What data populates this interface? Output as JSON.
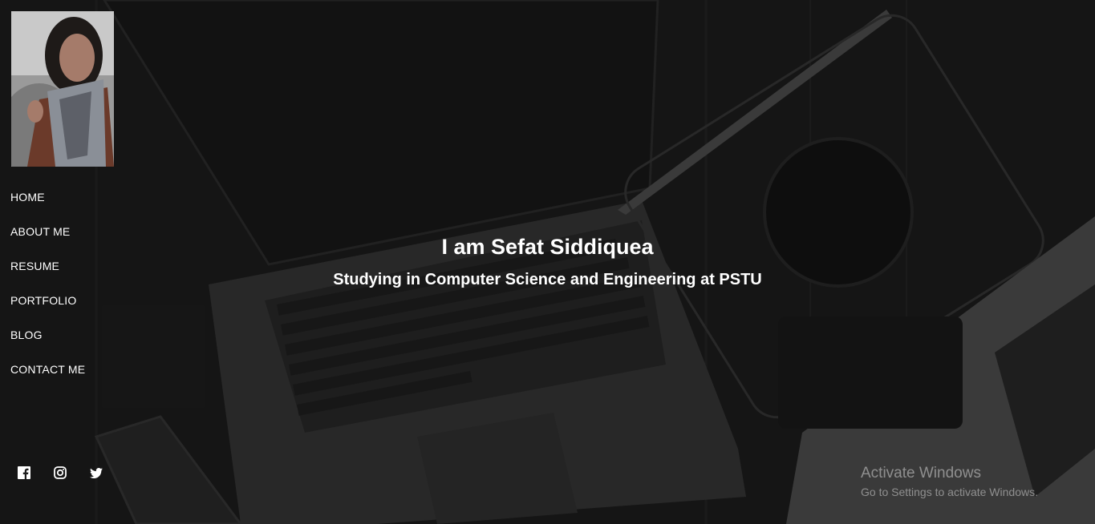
{
  "sidebar": {
    "nav": [
      {
        "label": "HOME"
      },
      {
        "label": "ABOUT ME"
      },
      {
        "label": "RESUME"
      },
      {
        "label": "PORTFOLIO"
      },
      {
        "label": "BLOG"
      },
      {
        "label": "CONTACT ME"
      }
    ],
    "social_icons": [
      "facebook-icon",
      "instagram-icon",
      "twitter-icon"
    ]
  },
  "hero": {
    "title": "I am Sefat Siddiquea",
    "subtitle": "Studying in Computer Science and Engineering at PSTU"
  },
  "watermark": {
    "title": "Activate Windows",
    "subtitle": "Go to Settings to activate Windows."
  },
  "colors": {
    "text": "#ffffff",
    "background": "#1b1b1b",
    "watermark": "#c8c8c8"
  }
}
